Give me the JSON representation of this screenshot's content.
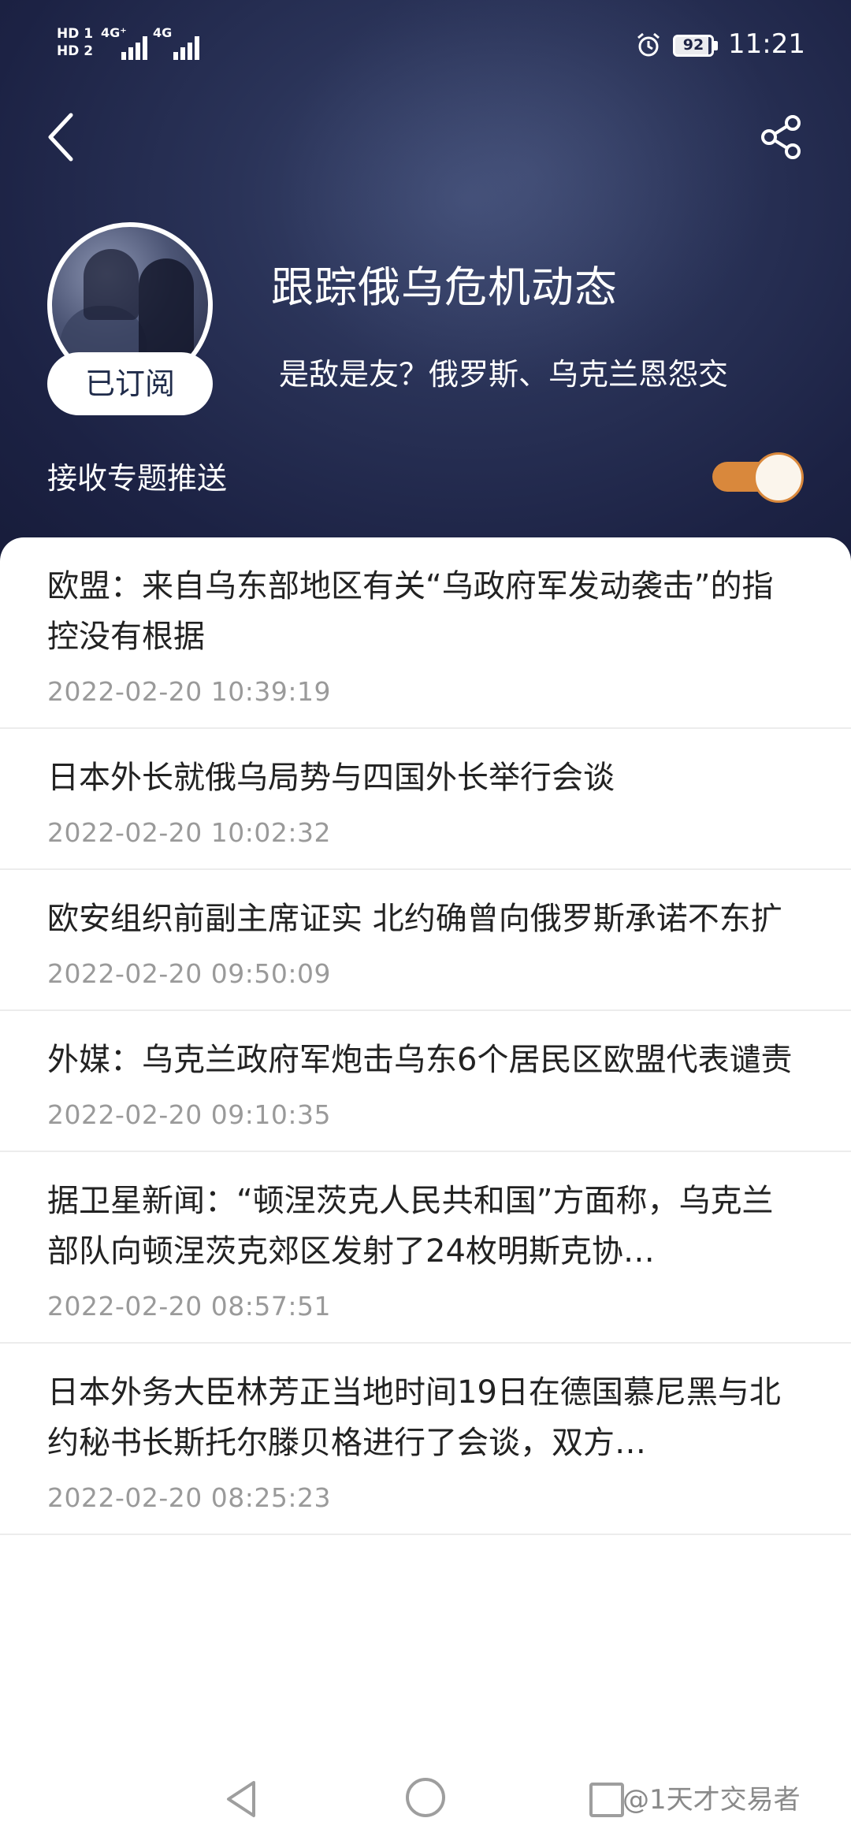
{
  "status_bar": {
    "hd1": "HD 1",
    "hd2": "HD 2",
    "signal1": "4G⁺",
    "signal2": "4G",
    "battery": "92",
    "time": "11:21"
  },
  "header": {
    "back_icon": "chevron-left-icon",
    "share_icon": "share-icon"
  },
  "topic": {
    "subscribed_label": "已订阅",
    "title": "跟踪俄乌危机动态",
    "subtitle": "是敌是友？俄罗斯、乌克兰恩怨交",
    "push_label": "接收专题推送",
    "push_enabled": true
  },
  "colors": {
    "toggle_accent": "#d9883c",
    "header_bg": "#1c2244"
  },
  "news": [
    {
      "title": "欧盟：来自乌东部地区有关“乌政府军发动袭击”的指控没有根据",
      "time": "2022-02-20 10:39:19"
    },
    {
      "title": "日本外长就俄乌局势与四国外长举行会谈",
      "time": "2022-02-20 10:02:32"
    },
    {
      "title": "欧安组织前副主席证实 北约确曾向俄罗斯承诺不东扩",
      "time": "2022-02-20 09:50:09"
    },
    {
      "title": "外媒：乌克兰政府军炮击乌东6个居民区欧盟代表谴责",
      "time": "2022-02-20 09:10:35"
    },
    {
      "title": "据卫星新闻：“顿涅茨克人民共和国”方面称，乌克兰部队向顿涅茨克郊区发射了24枚明斯克协…",
      "time": "2022-02-20 08:57:51"
    },
    {
      "title": "日本外务大臣林芳正当地时间19日在德国慕尼黑与北约秘书长斯托尔滕贝格进行了会谈，双方…",
      "time": "2022-02-20 08:25:23"
    }
  ],
  "nav": {
    "back_icon": "triangle-back-icon",
    "home_icon": "circle-home-icon",
    "recent_icon": "square-recent-icon"
  },
  "watermark": "@1天才交易者"
}
